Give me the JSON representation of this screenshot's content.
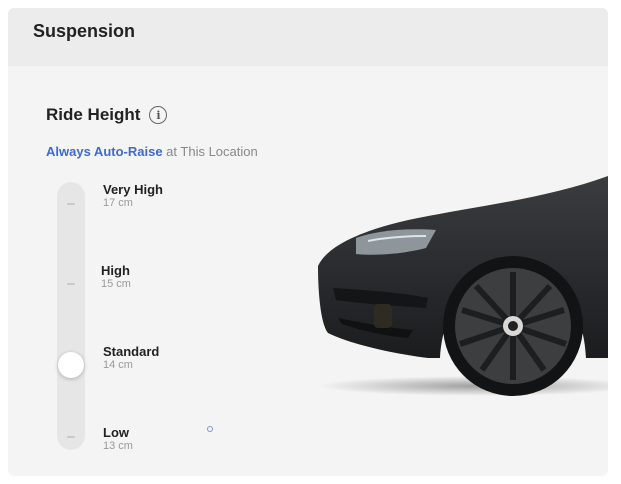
{
  "header": {
    "title": "Suspension"
  },
  "ride_height": {
    "title": "Ride Height",
    "info_icon": "info-icon",
    "auto_raise_link": "Always Auto-Raise",
    "auto_raise_rest": " at This Location",
    "selected": "Standard",
    "levels": [
      {
        "name": "Very High",
        "value": "17 cm"
      },
      {
        "name": "High",
        "value": "15 cm"
      },
      {
        "name": "Standard",
        "value": "14 cm"
      },
      {
        "name": "Low",
        "value": "13 cm"
      }
    ]
  },
  "colors": {
    "link": "#3e6ad1",
    "panel": "#f4f4f4",
    "header": "#ececec",
    "car_body": "#2a2c2e"
  }
}
